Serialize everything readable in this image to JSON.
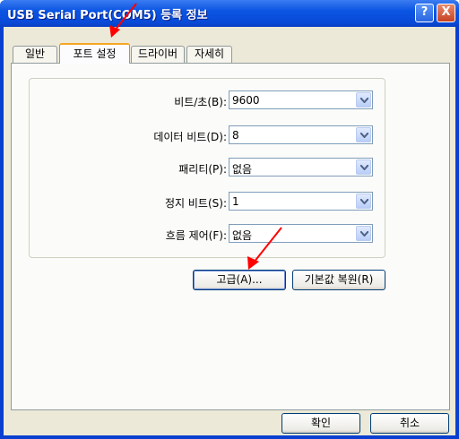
{
  "window": {
    "title": "USB Serial Port(COM5) 등록 정보",
    "help_label": "?",
    "close_label": "X"
  },
  "tabs": [
    {
      "label": "일반",
      "active": false
    },
    {
      "label": "포트 설정",
      "active": true
    },
    {
      "label": "드라이버",
      "active": false
    },
    {
      "label": "자세히",
      "active": false
    }
  ],
  "settings": [
    {
      "label": "비트/초(B):",
      "value": "9600"
    },
    {
      "label": "데이터 비트(D):",
      "value": "8"
    },
    {
      "label": "패리티(P):",
      "value": "없음"
    },
    {
      "label": "정지 비트(S):",
      "value": "1"
    },
    {
      "label": "흐름 제어(F):",
      "value": "없음"
    }
  ],
  "buttons": {
    "advanced": "고급(A)...",
    "restore_defaults": "기본값 복원(R)",
    "ok": "확인",
    "cancel": "취소"
  },
  "icons": {
    "dropdown": "chevron-down-icon",
    "annotation": "red-arrow-icon"
  },
  "colors": {
    "title_bar": "#0b55e3",
    "active_tab_accent": "#f5a623",
    "annotation_arrow": "#ff0000"
  }
}
